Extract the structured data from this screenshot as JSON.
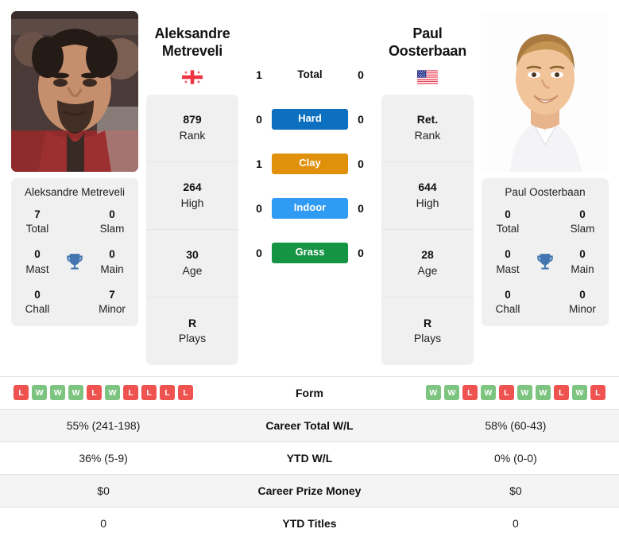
{
  "colors": {
    "win": "#7cc47f",
    "loss": "#ef5350",
    "hard": "#0d6fc0",
    "clay": "#e0900a",
    "indoor": "#2f9bf2",
    "grass": "#159443",
    "trophy": "#4376b0",
    "card_bg": "#f0f0f0",
    "row_stripe": "#f4f4f4"
  },
  "left_player": {
    "name_line1": "Aleksandre",
    "name_line2": "Metreveli",
    "full_name": "Aleksandre Metreveli",
    "flag": "georgia-flag",
    "photo": "player-photo-metreveli",
    "titles": [
      {
        "value": "7",
        "label": "Total"
      },
      {
        "value": "0",
        "label": "Slam"
      },
      {
        "value": "0",
        "label": "Mast"
      },
      {
        "value": "0",
        "label": "Main"
      },
      {
        "value": "0",
        "label": "Chall"
      },
      {
        "value": "7",
        "label": "Minor"
      }
    ],
    "attributes": [
      {
        "value": "879",
        "label": "Rank"
      },
      {
        "value": "264",
        "label": "High"
      },
      {
        "value": "30",
        "label": "Age"
      },
      {
        "value": "R",
        "label": "Plays"
      }
    ],
    "form": [
      "L",
      "W",
      "W",
      "W",
      "L",
      "W",
      "L",
      "L",
      "L",
      "L"
    ]
  },
  "right_player": {
    "name_line1": "Paul",
    "name_line2": "Oosterbaan",
    "full_name": "Paul Oosterbaan",
    "flag": "usa-flag",
    "photo": "player-photo-oosterbaan",
    "titles": [
      {
        "value": "0",
        "label": "Total"
      },
      {
        "value": "0",
        "label": "Slam"
      },
      {
        "value": "0",
        "label": "Mast"
      },
      {
        "value": "0",
        "label": "Main"
      },
      {
        "value": "0",
        "label": "Chall"
      },
      {
        "value": "0",
        "label": "Minor"
      }
    ],
    "attributes": [
      {
        "value": "Ret.",
        "label": "Rank"
      },
      {
        "value": "644",
        "label": "High"
      },
      {
        "value": "28",
        "label": "Age"
      },
      {
        "value": "R",
        "label": "Plays"
      }
    ],
    "form": [
      "W",
      "W",
      "L",
      "W",
      "L",
      "W",
      "W",
      "L",
      "W",
      "L"
    ]
  },
  "head_to_head": [
    {
      "label": "Total",
      "left": "1",
      "right": "0",
      "badge": false,
      "color": ""
    },
    {
      "label": "Hard",
      "left": "0",
      "right": "0",
      "badge": true,
      "color": "#0d6fc0"
    },
    {
      "label": "Clay",
      "left": "1",
      "right": "0",
      "badge": true,
      "color": "#e0900a"
    },
    {
      "label": "Indoor",
      "left": "0",
      "right": "0",
      "badge": true,
      "color": "#2f9bf2"
    },
    {
      "label": "Grass",
      "left": "0",
      "right": "0",
      "badge": true,
      "color": "#159443"
    }
  ],
  "stats_rows": [
    {
      "label": "Form",
      "left": "",
      "right": "",
      "type": "form",
      "striped": false
    },
    {
      "label": "Career Total W/L",
      "left": "55% (241-198)",
      "right": "58% (60-43)",
      "type": "text",
      "striped": true
    },
    {
      "label": "YTD W/L",
      "left": "36% (5-9)",
      "right": "0% (0-0)",
      "type": "text",
      "striped": false
    },
    {
      "label": "Career Prize Money",
      "left": "$0",
      "right": "$0",
      "type": "text",
      "striped": true
    },
    {
      "label": "YTD Titles",
      "left": "0",
      "right": "0",
      "type": "text",
      "striped": false
    }
  ]
}
